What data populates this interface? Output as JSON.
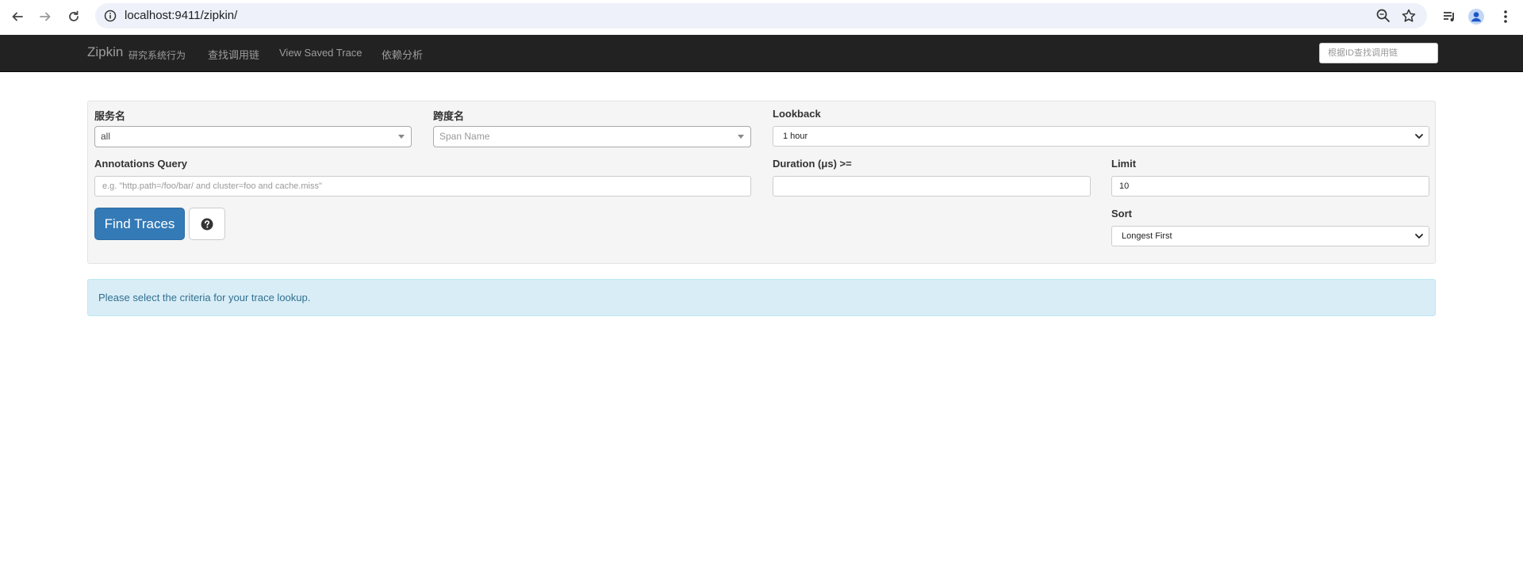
{
  "browser": {
    "url": "localhost:9411/zipkin/",
    "icons": [
      "back-arrow-icon",
      "forward-arrow-icon",
      "reload-icon",
      "site-info-icon",
      "zoom-icon",
      "bookmark-star-icon",
      "media-controls-icon",
      "profile-icon",
      "kebab-menu-icon"
    ]
  },
  "navbar": {
    "brand": "Zipkin",
    "brand_sub": "研究系统行为",
    "links": [
      "查找调用链",
      "View Saved Trace",
      "依赖分析"
    ],
    "search_placeholder": "根据ID查找调用链"
  },
  "search": {
    "service_label": "服务名",
    "service_value": "all",
    "span_label": "跨度名",
    "span_placeholder": "Span Name",
    "lookback_label": "Lookback",
    "lookback_value": "1 hour",
    "annotations_label": "Annotations Query",
    "annotations_placeholder": "e.g. \"http.path=/foo/bar/ and cluster=foo and cache.miss\"",
    "duration_label": "Duration (μs) >=",
    "duration_value": "",
    "limit_label": "Limit",
    "limit_value": "10",
    "sort_label": "Sort",
    "sort_value": "Longest First",
    "find_button": "Find Traces"
  },
  "alert": {
    "message": "Please select the criteria for your trace lookup."
  },
  "colors": {
    "navbar_bg": "#222222",
    "primary_button": "#337ab7",
    "alert_bg": "#d9edf7",
    "alert_text": "#31708f"
  }
}
